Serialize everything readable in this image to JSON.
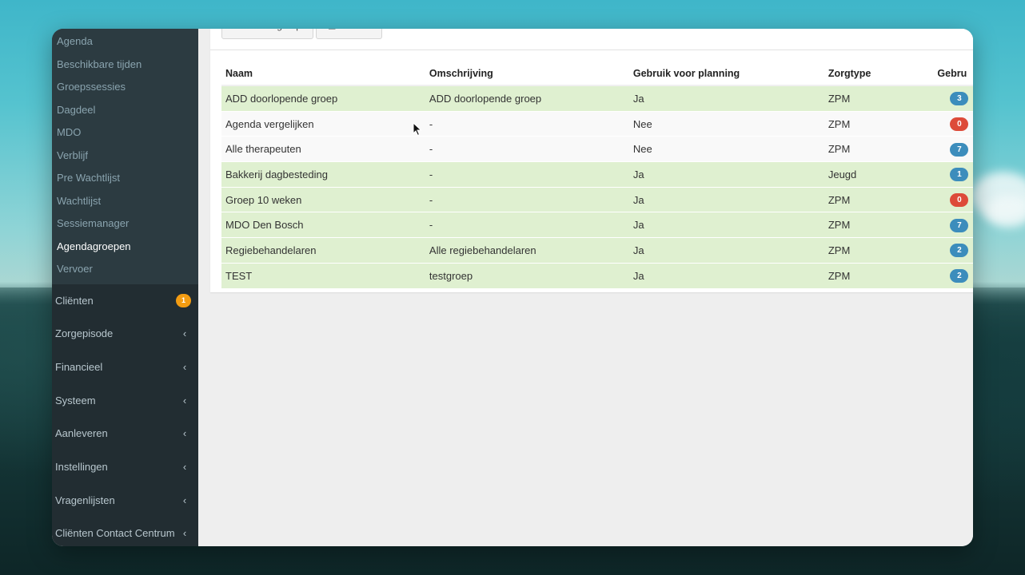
{
  "sidebar": {
    "submenu": [
      {
        "label": "Agenda",
        "active": false
      },
      {
        "label": "Beschikbare tijden",
        "active": false
      },
      {
        "label": "Groepssessies",
        "active": false
      },
      {
        "label": "Dagdeel",
        "active": false
      },
      {
        "label": "MDO",
        "active": false
      },
      {
        "label": "Verblijf",
        "active": false
      },
      {
        "label": "Pre Wachtlijst",
        "active": false
      },
      {
        "label": "Wachtlijst",
        "active": false
      },
      {
        "label": "Sessiemanager",
        "active": false
      },
      {
        "label": "Agendagroepen",
        "active": true
      },
      {
        "label": "Vervoer",
        "active": false
      }
    ],
    "menu": [
      {
        "label": "Cliënten",
        "badge": "1"
      },
      {
        "label": "Zorgepisode",
        "chevron": "‹"
      },
      {
        "label": "Financieel",
        "chevron": "‹"
      },
      {
        "label": "Systeem",
        "chevron": "‹"
      },
      {
        "label": "Aanleveren",
        "chevron": "‹"
      },
      {
        "label": "Instellingen",
        "chevron": "‹"
      },
      {
        "label": "Vragenlijsten",
        "chevron": "‹"
      },
      {
        "label": "Cliënten Contact Centrum",
        "chevron": "‹"
      }
    ]
  },
  "toolbar": {
    "create_label": "Creëer groep",
    "create_icon": "plus-circle-icon",
    "archive_label": "Archief",
    "archive_icon": "archive-icon"
  },
  "table": {
    "headers": [
      "Naam",
      "Omschrijving",
      "Gebruik voor planning",
      "Zorgtype",
      "Gebru"
    ],
    "rows": [
      {
        "naam": "ADD doorlopende groep",
        "omschrijving": "ADD doorlopende groep",
        "planning": "Ja",
        "zorgtype": "ZPM",
        "count": "3",
        "count_color": "#3c8dbc",
        "row_color": "green"
      },
      {
        "naam": "Agenda vergelijken",
        "omschrijving": "-",
        "planning": "Nee",
        "zorgtype": "ZPM",
        "count": "0",
        "count_color": "#dd4b39",
        "row_color": "gray"
      },
      {
        "naam": "Alle therapeuten",
        "omschrijving": "-",
        "planning": "Nee",
        "zorgtype": "ZPM",
        "count": "7",
        "count_color": "#3c8dbc",
        "row_color": "gray"
      },
      {
        "naam": "Bakkerij dagbesteding",
        "omschrijving": "-",
        "planning": "Ja",
        "zorgtype": "Jeugd",
        "count": "1",
        "count_color": "#3c8dbc",
        "row_color": "green"
      },
      {
        "naam": "Groep 10 weken",
        "omschrijving": "-",
        "planning": "Ja",
        "zorgtype": "ZPM",
        "count": "0",
        "count_color": "#dd4b39",
        "row_color": "green"
      },
      {
        "naam": "MDO Den Bosch",
        "omschrijving": "-",
        "planning": "Ja",
        "zorgtype": "ZPM",
        "count": "7",
        "count_color": "#3c8dbc",
        "row_color": "green"
      },
      {
        "naam": "Regiebehandelaren",
        "omschrijving": "Alle regiebehandelaren",
        "planning": "Ja",
        "zorgtype": "ZPM",
        "count": "2",
        "count_color": "#3c8dbc",
        "row_color": "green"
      },
      {
        "naam": "TEST",
        "omschrijving": "testgroep",
        "planning": "Ja",
        "zorgtype": "ZPM",
        "count": "2",
        "count_color": "#3c8dbc",
        "row_color": "green"
      }
    ]
  }
}
